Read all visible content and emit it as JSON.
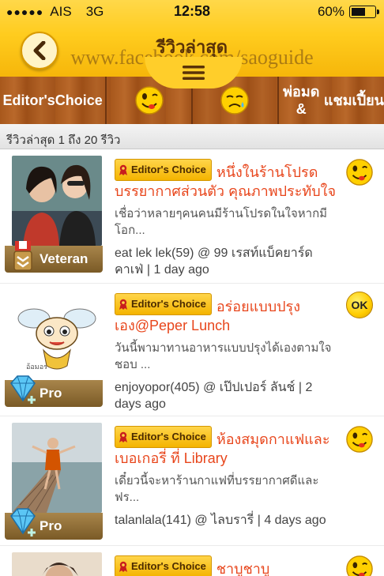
{
  "status_bar": {
    "carrier": "AIS",
    "network": "3G",
    "time": "12:58",
    "battery": "60%",
    "battery_fraction": 0.6
  },
  "header": {
    "title": "รีวิวล่าสุด",
    "watermark": "www.facebook.com/saoguide",
    "back_icon": "chevron-left-icon",
    "menu_icon": "hamburger-icon"
  },
  "filters": [
    {
      "label": "Editor's Choice"
    },
    {
      "icon": "yummy-face-icon"
    },
    {
      "icon": "sad-face-icon"
    },
    {
      "label": "พ่อมด & แชมเปี้ยน"
    }
  ],
  "summary": "รีวิวล่าสุด 1 ถึง 20 รีวิว",
  "reviews": [
    {
      "tag": "Editor's Choice",
      "title": "หนึ่งในร้านโปรด บรรยากาศส่วนตัว คุณภาพประทับใจ",
      "snippet": "เชื่อว่าหลายๆคนคนมีร้านโปรดในใจหากมีโอก...",
      "meta": "eat lek lek(59) @ 99 เรสท์แบ็คยาร์ดคาเฟ่ | 1 day ago",
      "badge": "Veteran",
      "rating_icon": "yummy-face-icon"
    },
    {
      "tag": "Editor's Choice",
      "title": "อร่อยแบบปรุงเอง@Peper Lunch",
      "snippet": "วันนี้พามาทานอาหารแบบปรุงได้เองตามใจชอบ ...",
      "meta": "enjoyopor(405) @ เป๊ปเปอร์ ลันช์ | 2 days ago",
      "badge": "Pro",
      "rating": "OK",
      "avatar_text": "อ้อมอร"
    },
    {
      "tag": "Editor's Choice",
      "title": "ห้องสมุดกาแฟและเบอเกอรี่ ที่ Library",
      "snippet": "เดี๋ยวนี้จะหาร้านกาแฟที่บรรยากาศดีและฟร...",
      "meta": "talanlala(141) @ ไลบรารี่ | 4 days ago",
      "badge": "Pro",
      "rating_icon": "yummy-face-icon"
    },
    {
      "tag": "Editor's Choice",
      "title": "ชาบูชาบู",
      "rating_icon": "yummy-face-icon"
    }
  ],
  "colors": {
    "header_yellow": "#ffcc1e",
    "wood": "#a8581c",
    "title_orange": "#e8461c",
    "badge_brown": "#8a6832"
  }
}
